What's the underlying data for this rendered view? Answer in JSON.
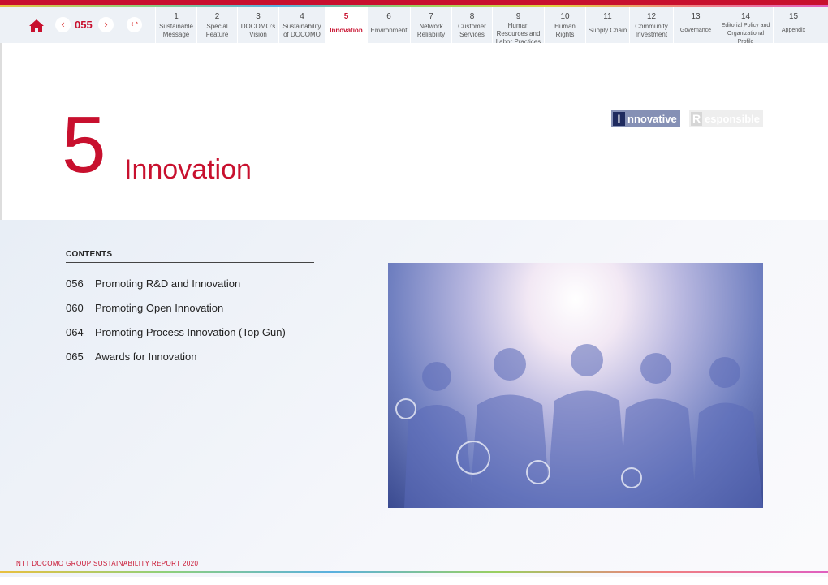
{
  "nav": {
    "page": "055",
    "prev_icon": "chevron-left-icon",
    "next_icon": "chevron-right-icon",
    "home_icon": "home-icon",
    "back_icon": "return-icon",
    "tabs": [
      {
        "num": "1",
        "label": "Sustainable Message"
      },
      {
        "num": "2",
        "label": "Special Feature"
      },
      {
        "num": "3",
        "label": "DOCOMO's Vision"
      },
      {
        "num": "4",
        "label": "Sustainability of DOCOMO"
      },
      {
        "num": "5",
        "label": "Innovation"
      },
      {
        "num": "6",
        "label": "Environment"
      },
      {
        "num": "7",
        "label": "Network Reliability"
      },
      {
        "num": "8",
        "label": "Customer Services"
      },
      {
        "num": "9",
        "label": "Human Resources and Labor Practices"
      },
      {
        "num": "10",
        "label": "Human Rights"
      },
      {
        "num": "11",
        "label": "Supply Chain"
      },
      {
        "num": "12",
        "label": "Community Investment"
      },
      {
        "num": "13",
        "label": "Governance"
      },
      {
        "num": "14",
        "label": "Editorial Policy and Organizational Profile"
      },
      {
        "num": "15",
        "label": "Appendix"
      }
    ],
    "active": "5"
  },
  "hero": {
    "number": "5",
    "title": "Innovation",
    "badges": [
      {
        "key": "I",
        "rest": "nnovative",
        "bg": "#8590b5",
        "keybg": "#1e2a5e"
      },
      {
        "key": "R",
        "rest": "esponsible",
        "bg": "#eeeeee",
        "keybg": "#d6d6d6"
      }
    ]
  },
  "contents": {
    "heading": "CONTENTS",
    "items": [
      {
        "page": "056",
        "title": "Promoting R&D and Innovation"
      },
      {
        "page": "060",
        "title": "Promoting Open Innovation"
      },
      {
        "page": "064",
        "title": "Promoting Process Innovation (Top Gun)"
      },
      {
        "page": "065",
        "title": "Awards for Innovation"
      }
    ]
  },
  "footer": "NTT DOCOMO GROUP SUSTAINABILITY REPORT 2020",
  "colors": {
    "accent": "#c8102e",
    "nav_bg": "#edf1f6"
  }
}
